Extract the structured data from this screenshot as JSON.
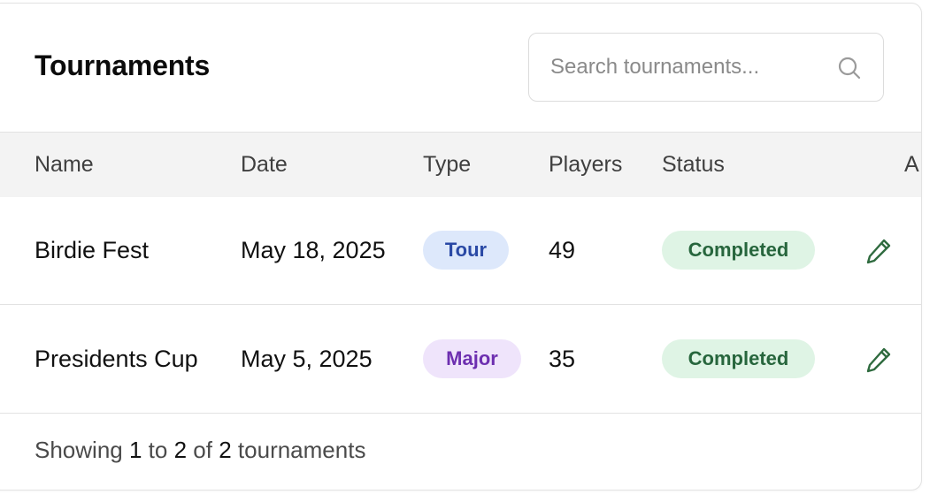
{
  "header": {
    "title": "Tournaments",
    "search_placeholder": "Search tournaments..."
  },
  "table": {
    "columns": [
      "Name",
      "Date",
      "Type",
      "Players",
      "Status",
      "A"
    ],
    "rows": [
      {
        "name": "Birdie Fest",
        "date": "May 18, 2025",
        "type": "Tour",
        "players": "49",
        "status": "Completed"
      },
      {
        "name": "Presidents Cup",
        "date": "May 5, 2025",
        "type": "Major",
        "players": "35",
        "status": "Completed"
      }
    ]
  },
  "footer": {
    "prefix": "Showing",
    "from": "1",
    "to_word": "to",
    "to": "2",
    "of_word": "of",
    "total": "2",
    "suffix": "tournaments"
  },
  "colors": {
    "tour_bg": "#dde8fb",
    "tour_text": "#2a49a5",
    "major_bg": "#efe4fb",
    "major_text": "#6d2fb0",
    "completed_bg": "#dff4e5",
    "completed_text": "#27663d",
    "edit_icon": "#2f6b3f"
  },
  "icons": {
    "search": "search-icon",
    "edit": "pencil-icon"
  }
}
